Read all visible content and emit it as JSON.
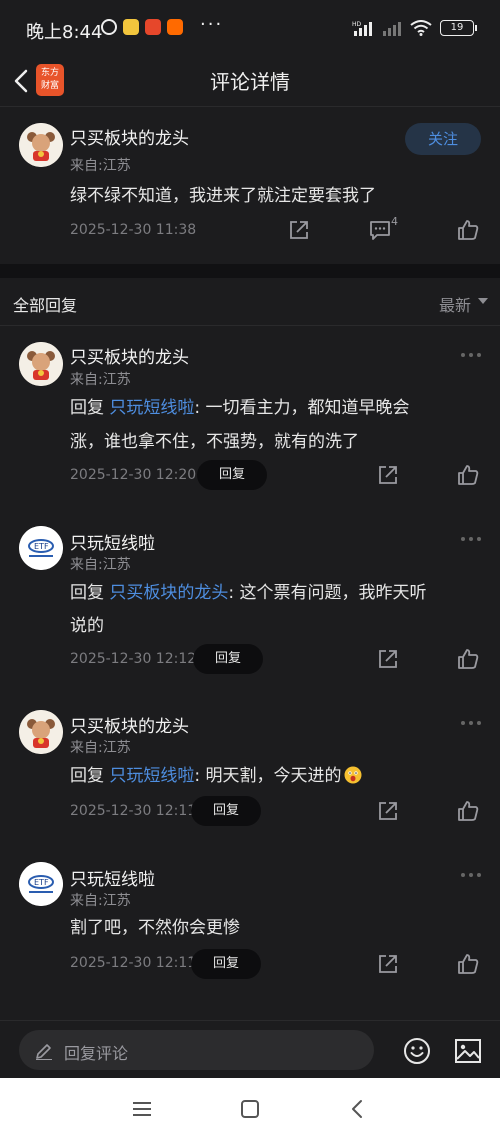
{
  "status_bar": {
    "time": "晚上8:44",
    "more": "···",
    "hd": "HD",
    "battery": "19"
  },
  "header": {
    "title": "评论详情",
    "logo_text_line1": "东方",
    "logo_text_line2": "财富"
  },
  "main_comment": {
    "username": "只买板块的龙头",
    "from": "来自:江苏",
    "content": "绿不绿不知道，我进来了就注定要套我了",
    "time": "2025-12-30 11:38",
    "follow_label": "关注",
    "comment_count": "4"
  },
  "replies_section": {
    "title": "全部回复",
    "sort_label": "最新"
  },
  "replies": [
    {
      "username": "只买板块的龙头",
      "from": "来自:江苏",
      "prefix": "回复 ",
      "mention": "只玩短线啦",
      "text_line1": ": 一切看主力，都知道早晚会",
      "text_line2": "涨，谁也拿不住，不强势，就有的洗了",
      "time": "2025-12-30 12:20",
      "reply_label": "回复"
    },
    {
      "username": "只玩短线啦",
      "from": "来自:江苏",
      "prefix": "回复 ",
      "mention": "只买板块的龙头",
      "text_line1": ": 这个票有问题，我昨天听",
      "text_line2": "说的",
      "time": "2025-12-30 12:12",
      "reply_label": "回复"
    },
    {
      "username": "只买板块的龙头",
      "from": "来自:江苏",
      "prefix": "回复 ",
      "mention": "只玩短线啦",
      "text_line1": ": 明天割，今天进的",
      "time": "2025-12-30 12:11",
      "reply_label": "回复"
    },
    {
      "username": "只玩短线啦",
      "from": "来自:江苏",
      "text_line1": "割了吧，不然你会更惨",
      "time": "2025-12-30 12:11",
      "reply_label": "回复"
    }
  ],
  "bottom_bar": {
    "placeholder": "回复评论"
  },
  "colors": {
    "background": "#1c1c1e",
    "accent_blue": "#4e8ee0",
    "brand_orange": "#e8542a"
  },
  "icons": [
    "back-icon",
    "share-icon",
    "comment-icon",
    "like-icon",
    "more-icon",
    "pen-icon",
    "emoji-icon",
    "image-icon",
    "menu-icon",
    "home-icon",
    "nav-back-icon"
  ]
}
